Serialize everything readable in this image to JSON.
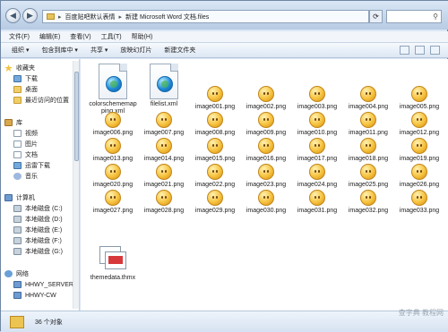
{
  "window": {
    "breadcrumb": [
      "百度贴吧默认表情",
      "新建 Microsoft Word 文档.files"
    ],
    "refresh_icon": "refresh-icon",
    "search_icon": "search-icon"
  },
  "menu": [
    "文件(F)",
    "编辑(E)",
    "查看(V)",
    "工具(T)",
    "帮助(H)"
  ],
  "toolbar": [
    "组织 ▾",
    "包含到库中 ▾",
    "共享 ▾",
    "放映幻灯片",
    "新建文件夹"
  ],
  "sidebar": {
    "favorites": {
      "label": "收藏夹",
      "items": [
        "下载",
        "桌面",
        "最近访问的位置"
      ]
    },
    "library": {
      "label": "库",
      "items": [
        "视频",
        "图片",
        "文档",
        "迅雷下载",
        "音乐"
      ]
    },
    "computer": {
      "label": "计算机",
      "items": [
        "本地磁盘 (C:)",
        "本地磁盘 (D:)",
        "本地磁盘 (E:)",
        "本地磁盘 (F:)",
        "本地磁盘 (G:)"
      ]
    },
    "network": {
      "label": "网络",
      "items": [
        "HHWY_SERVER",
        "HHWY-CW"
      ]
    }
  },
  "files": [
    "colorschememapping.xml",
    "filelist.xml",
    "image001.png",
    "image002.png",
    "image003.png",
    "image004.png",
    "image005.png",
    "image006.png",
    "image007.png",
    "image008.png",
    "image009.png",
    "image010.png",
    "image011.png",
    "image012.png",
    "image013.png",
    "image014.png",
    "image015.png",
    "image016.png",
    "image017.png",
    "image018.png",
    "image019.png",
    "image020.png",
    "image021.png",
    "image022.png",
    "image023.png",
    "image024.png",
    "image025.png",
    "image026.png",
    "image027.png",
    "image028.png",
    "image029.png",
    "image030.png",
    "image031.png",
    "image032.png",
    "image033.png",
    "themedata.thmx"
  ],
  "status": {
    "count": "36 个对象"
  },
  "watermark": "查字典 教程网"
}
